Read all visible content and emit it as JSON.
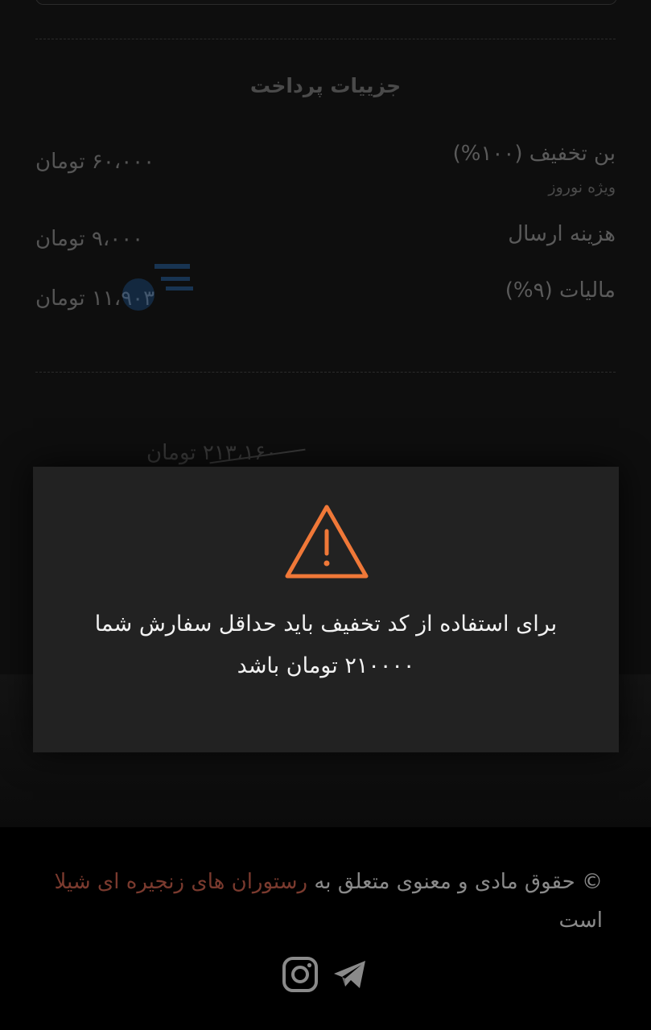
{
  "payment": {
    "title": "جزییات پرداخت",
    "rows": [
      {
        "label": "بن تخفیف (۱۰۰%)",
        "sub": "ویژه نوروز",
        "value": "۶۰،۰۰۰ تومان"
      },
      {
        "label": "هزینه ارسال",
        "value": "۹،۰۰۰ تومان"
      },
      {
        "label": "مالیات (۹%)",
        "value": "۱۱،۹۰۳ تومان"
      }
    ],
    "strikethrough_total": "۲۱۳،۱۶۰ تومان"
  },
  "modal": {
    "icon": "warning-triangle-icon",
    "accent_color": "#f07838",
    "message_line1": "برای استفاده از کد تخفیف باید حداقل سفارش شما",
    "message_line2": "۲۱۰۰۰۰ تومان باشد"
  },
  "footer": {
    "copyright_prefix": "© حقوق مادی و معنوی متعلق به",
    "brand_name": "رستوران های زنجیره ای شیلا",
    "copyright_suffix": "است",
    "brand_color": "#7a3a2e",
    "social": [
      "telegram-icon",
      "instagram-icon"
    ]
  }
}
